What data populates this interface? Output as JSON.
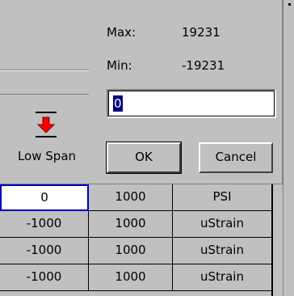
{
  "dialog": {
    "max_label": "Max:",
    "max_value": "19231",
    "min_label": "Min:",
    "min_value": "-19231",
    "input_value": "0",
    "ok_label": "OK",
    "cancel_label": "Cancel"
  },
  "toolbar": {
    "low_span_label": "Low Span",
    "low_span_icon": "low-span-arrow-icon",
    "icon_color": "#ff0000"
  },
  "grid": {
    "rows": [
      {
        "low": "0",
        "high": "1000",
        "unit": "PSI"
      },
      {
        "low": "-1000",
        "high": "1000",
        "unit": "uStrain"
      },
      {
        "low": "-1000",
        "high": "1000",
        "unit": "uStrain"
      },
      {
        "low": "-1000",
        "high": "1000",
        "unit": "uStrain"
      }
    ]
  }
}
